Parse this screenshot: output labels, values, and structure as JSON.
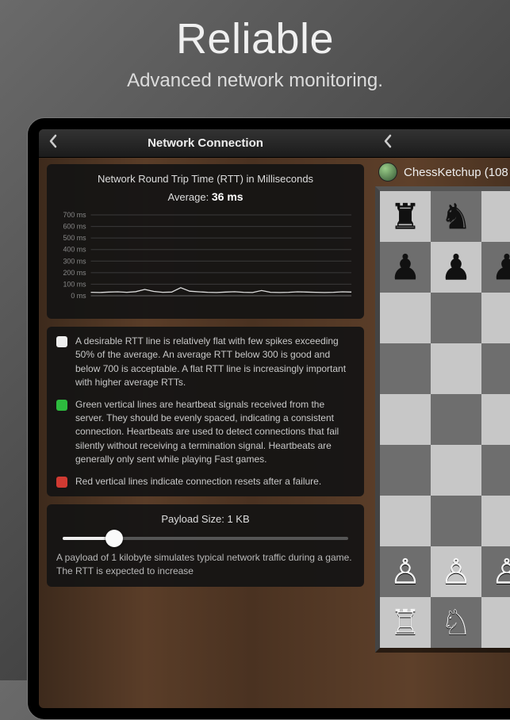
{
  "promo": {
    "title": "Reliable",
    "subtitle": "Advanced network monitoring."
  },
  "left": {
    "title": "Network Connection",
    "chart_title": "Network Round Trip Time (RTT) in Milliseconds",
    "chart_avg_label": "Average:",
    "chart_avg_value": "36 ms",
    "legend": {
      "white": "A desirable RTT line is relatively flat with few spikes exceeding 50% of the average.  An average RTT below 300 is good and below 700 is acceptable. A flat RTT line is increasingly important with higher average RTTs.",
      "green": "Green vertical lines are heartbeat signals received from the server. They should be evenly spaced, indicating a consistent connection. Heartbeats are used to detect connections that fail silently without receiving a termination signal.  Heartbeats are generally only sent while playing Fast games.",
      "red": "Red vertical lines indicate connection resets after a failure."
    },
    "payload": {
      "header": "Payload Size: 1 KB",
      "desc": "A payload of 1 kilobyte simulates typical network traffic during a game.  The RTT is expected to increase",
      "value_pct": 18
    }
  },
  "right": {
    "opponent": "ChessKetchup (108"
  },
  "chart_data": {
    "type": "line",
    "title": "Network Round Trip Time (RTT) in Milliseconds",
    "ylabel": "ms",
    "xlabel": "",
    "ylim": [
      0,
      700
    ],
    "y_ticks": [
      "700 ms",
      "600 ms",
      "500 ms",
      "400 ms",
      "300 ms",
      "200 ms",
      "100 ms",
      "0 ms"
    ],
    "x": [
      0,
      1,
      2,
      3,
      4,
      5,
      6,
      7,
      8,
      9,
      10,
      11,
      12,
      13,
      14,
      15,
      16,
      17,
      18,
      19,
      20,
      21,
      22,
      23,
      24,
      25,
      26,
      27,
      28,
      29
    ],
    "values": [
      30,
      28,
      32,
      34,
      30,
      36,
      55,
      38,
      30,
      32,
      70,
      40,
      34,
      30,
      28,
      32,
      35,
      30,
      28,
      45,
      30,
      28,
      30,
      34,
      32,
      30,
      28,
      30,
      34,
      32
    ],
    "average": 36
  },
  "board": {
    "rows": [
      [
        "♜",
        "♞",
        ""
      ],
      [
        "♟",
        "♟",
        "♟"
      ],
      [
        "",
        "",
        ""
      ],
      [
        "",
        "",
        ""
      ],
      [
        "",
        "",
        ""
      ],
      [
        "",
        "",
        ""
      ],
      [
        "",
        "",
        ""
      ],
      [
        "♙",
        "♙",
        "♙"
      ],
      [
        "♖",
        "♘",
        ""
      ]
    ]
  }
}
